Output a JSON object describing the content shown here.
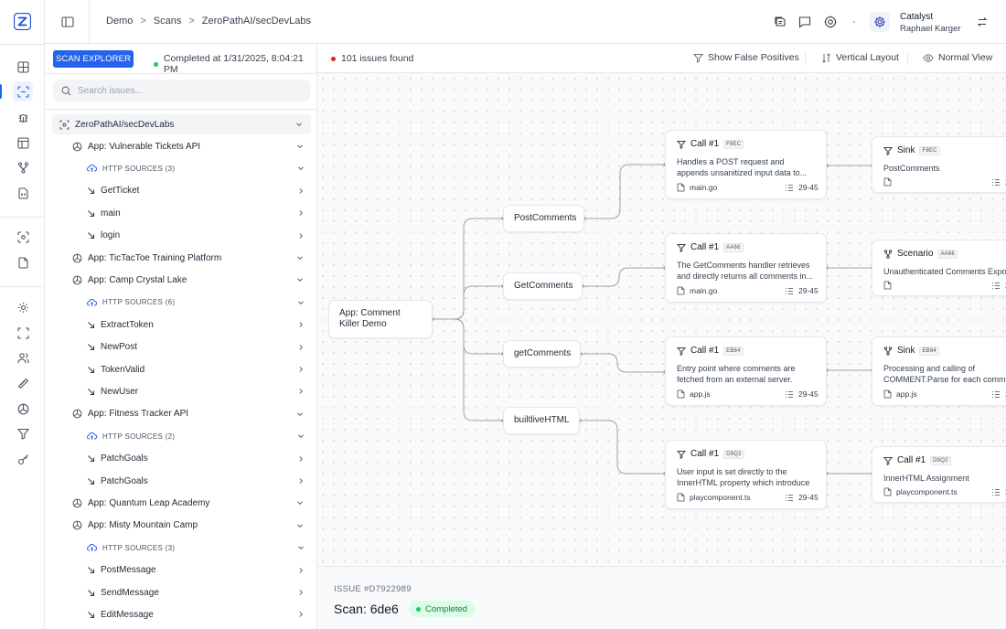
{
  "app": {
    "logo": "zeropath-logo"
  },
  "rail": {
    "items": [
      {
        "icon": "dashboard-icon"
      },
      {
        "icon": "scan-icon",
        "active": true
      },
      {
        "icon": "bug-icon"
      },
      {
        "icon": "layout-icon"
      },
      {
        "icon": "git-branch-icon"
      },
      {
        "icon": "file-code-icon"
      },
      {
        "icon": "scan-face-icon"
      },
      {
        "icon": "document-icon"
      },
      {
        "icon": "settings-icon"
      },
      {
        "icon": "expand-icon"
      },
      {
        "icon": "users-icon"
      },
      {
        "icon": "ruler-icon"
      },
      {
        "icon": "integrations-icon"
      },
      {
        "icon": "filter-icon"
      },
      {
        "icon": "key-icon"
      }
    ]
  },
  "header": {
    "breadcrumb": [
      "Demo",
      "Scans",
      "ZeroPathAI/secDevLabs"
    ],
    "breadcrumb_sep": ">",
    "workspace_name": "Catalyst",
    "workspace_user": "Raphael Karger"
  },
  "panel": {
    "scan_explorer_label": "SCAN EXPLORER",
    "completed_text": "Completed at 1/31/2025, 8:04:21 PM",
    "search_placeholder": "Search issues...",
    "tree": {
      "root": "ZeroPathAI/secDevLabs",
      "rows": [
        {
          "kind": "app",
          "label": "App: Vulnerable Tickets API",
          "expanded": true
        },
        {
          "kind": "src",
          "label": "HTTP SOURCES (3)"
        },
        {
          "kind": "ep",
          "label": "GetTicket"
        },
        {
          "kind": "ep",
          "label": "main"
        },
        {
          "kind": "ep",
          "label": "login"
        },
        {
          "kind": "app",
          "label": "App: TicTacToe Training Platform",
          "expanded": false
        },
        {
          "kind": "app",
          "label": "App: Camp Crystal Lake",
          "expanded": true
        },
        {
          "kind": "src",
          "label": "HTTP SOURCES (6)"
        },
        {
          "kind": "ep",
          "label": "ExtractToken"
        },
        {
          "kind": "ep",
          "label": "NewPost"
        },
        {
          "kind": "ep",
          "label": "TokenValid"
        },
        {
          "kind": "ep",
          "label": "NewUser"
        },
        {
          "kind": "app",
          "label": "App: Fitness Tracker API",
          "expanded": true
        },
        {
          "kind": "src",
          "label": "HTTP SOURCES (2)"
        },
        {
          "kind": "ep",
          "label": "PatchGoals"
        },
        {
          "kind": "ep",
          "label": "PatchGoals"
        },
        {
          "kind": "app",
          "label": "App: Quantum Leap Academy",
          "expanded": false
        },
        {
          "kind": "app",
          "label": "App: Misty Mountain Camp",
          "expanded": true
        },
        {
          "kind": "src",
          "label": "HTTP SOURCES (3)"
        },
        {
          "kind": "ep",
          "label": "PostMessage"
        },
        {
          "kind": "ep",
          "label": "SendMessage"
        },
        {
          "kind": "ep",
          "label": "EditMessage"
        }
      ]
    }
  },
  "toolbar": {
    "issues_found": "101 issues found",
    "show_false_positives": "Show False Positives",
    "vertical_layout": "Vertical Layout",
    "normal_view": "Normal View"
  },
  "graph": {
    "root": "App: Comment Killer Demo",
    "endpoints": [
      "PostComments",
      "GetComments",
      "getComments",
      "builtliveHTML"
    ],
    "calls": [
      {
        "icon": "filter-icon",
        "title": "Call #1",
        "tag": "F8EC",
        "desc": "Handles a POST request and appends unsanitized input data to...",
        "file": "main.go",
        "lines": "29-45"
      },
      {
        "icon": "filter-icon",
        "title": "Call #1",
        "tag": "AA66",
        "desc": "The GetComments handler retrieves and directly returns all comments in...",
        "file": "main.go",
        "lines": "29-45"
      },
      {
        "icon": "filter-icon",
        "title": "Call #1",
        "tag": "EB84",
        "desc": "Entry point where comments are fetched from an external server.",
        "file": "app.js",
        "lines": "29-45"
      },
      {
        "icon": "filter-icon",
        "title": "Call #1",
        "tag": "D9Q2",
        "desc": "User input is set directly to the InnerHTML property which introduce",
        "file": "playcomponent.ts",
        "lines": "29-45"
      }
    ],
    "sinks": [
      {
        "icon": "sink-icon",
        "title": "Sink",
        "tag": "F8EC",
        "desc": "PostComments",
        "file": "",
        "lines": "2"
      },
      {
        "icon": "scenario-icon",
        "title": "Scenario",
        "tag": "AA66",
        "desc": "Unauthenticated Comments Expo",
        "file": "",
        "lines": "2"
      },
      {
        "icon": "scenario-icon",
        "title": "Sink",
        "tag": "EB84",
        "desc": "Processing and calling of COMMENT.Parse for each comme",
        "file": "app.js",
        "lines": "2"
      },
      {
        "icon": "filter-icon",
        "title": "Call #1",
        "tag": "D9Q2",
        "desc": "InnerHTML Assignment",
        "file": "playcomponent.ts",
        "lines": "2"
      }
    ]
  },
  "issue": {
    "id": "ISSUE #D7922989",
    "title": "Scan: 6de6",
    "status": "Completed"
  },
  "colors": {
    "accent": "#2563eb",
    "success": "#22c55e",
    "danger": "#dc2626"
  }
}
